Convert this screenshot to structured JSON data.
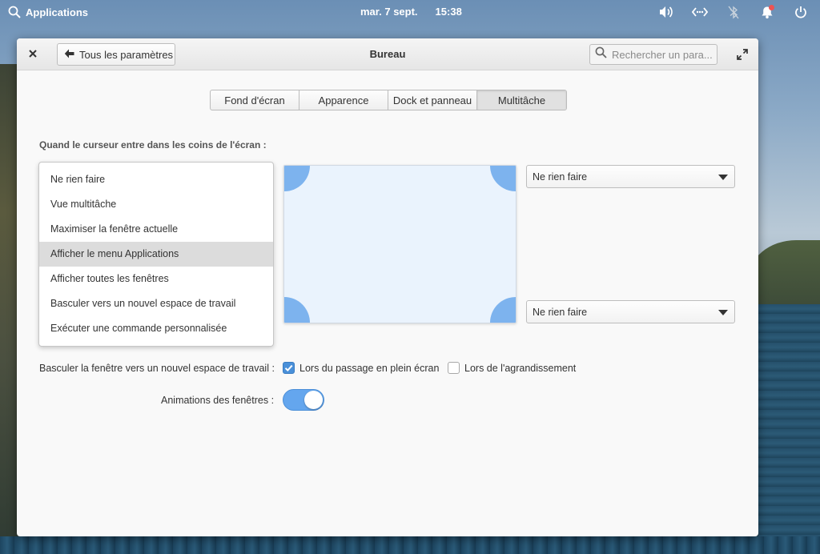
{
  "panel": {
    "apps_label": "Applications",
    "date": "mar. 7 sept.",
    "time": "15:38",
    "tray_icons": [
      "volume-icon",
      "network-icon",
      "bluetooth-off-icon",
      "notifications-icon",
      "power-icon"
    ]
  },
  "window": {
    "title": "Bureau",
    "back_label": "Tous les paramètres",
    "search_placeholder": "Rechercher un para..."
  },
  "tabs": [
    {
      "label": "Fond d'écran",
      "active": false
    },
    {
      "label": "Apparence",
      "active": false
    },
    {
      "label": "Dock et panneau",
      "active": false
    },
    {
      "label": "Multitâche",
      "active": true
    }
  ],
  "hot_corners": {
    "heading": "Quand le curseur entre dans les coins de l'écran :",
    "options": [
      "Ne rien faire",
      "Vue multitâche",
      "Maximiser la fenêtre actuelle",
      "Afficher le menu Applications",
      "Afficher toutes les fenêtres",
      "Basculer vers un nouvel espace de travail",
      "Exécuter une commande personnalisée"
    ],
    "highlighted_option": "Afficher le menu Applications",
    "top_right_value": "Ne rien faire",
    "bottom_right_value": "Ne rien faire"
  },
  "workspace": {
    "label": "Basculer la fenêtre vers un nouvel espace de travail :",
    "fullscreen_label": "Lors du passage en plein écran",
    "fullscreen_checked": true,
    "maximize_label": "Lors de l'agrandissement",
    "maximize_checked": false
  },
  "animations": {
    "label": "Animations des fenêtres :",
    "enabled": true
  },
  "colors": {
    "accent": "#4a90d9",
    "corner": "#7db3ee",
    "toggle_on": "#64a6ee"
  }
}
